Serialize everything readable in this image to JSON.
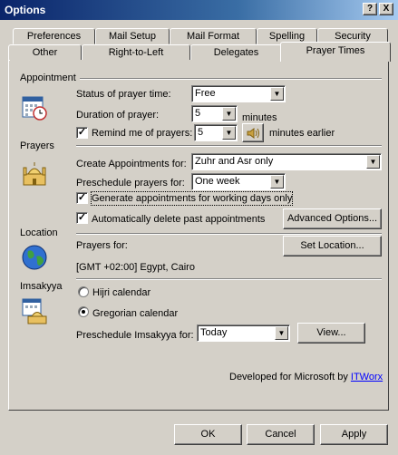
{
  "window": {
    "title": "Options",
    "help_btn": "?",
    "close_btn": "X"
  },
  "tabs_row1": [
    "Preferences",
    "Mail Setup",
    "Mail Format",
    "Spelling",
    "Security"
  ],
  "tabs_row2": [
    "Other",
    "Right-to-Left",
    "Delegates",
    "Prayer Times"
  ],
  "sections": {
    "appointment": "Appointment",
    "prayers": "Prayers",
    "location": "Location",
    "imsakyya": "Imsakyya"
  },
  "appointment": {
    "status_label": "Status of prayer time:",
    "status_value": "Free",
    "duration_label": "Duration of prayer:",
    "duration_value": "5",
    "duration_unit": "minutes",
    "remind_label": "Remind me of prayers:",
    "remind_value": "5",
    "remind_unit": "minutes earlier",
    "remind_checked": "✓"
  },
  "prayers": {
    "create_label": "Create Appointments for:",
    "create_value": "Zuhr and Asr only",
    "preschedule_label": "Preschedule prayers for:",
    "preschedule_value": "One week",
    "working_days_label": "Generate appointments for working days only",
    "working_days_checked": "✓",
    "auto_delete_label": "Automatically delete past appointments",
    "auto_delete_checked": "✓",
    "advanced_button": "Advanced Options..."
  },
  "location": {
    "prayers_for_label": "Prayers for:",
    "set_location_button": "Set Location...",
    "location_value": "[GMT +02:00] Egypt, Cairo"
  },
  "imsakyya": {
    "hijri_label": "Hijri calendar",
    "gregorian_label": "Gregorian calendar",
    "preschedule_label": "Preschedule Imsakyya for:",
    "preschedule_value": "Today",
    "view_button": "View..."
  },
  "footer": {
    "developed_text": "Developed for Microsoft by",
    "developer_link": "ITWorx"
  },
  "buttons": {
    "ok": "OK",
    "cancel": "Cancel",
    "apply": "Apply"
  }
}
